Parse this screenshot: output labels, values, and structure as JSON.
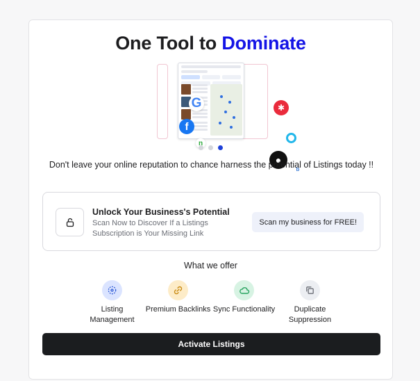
{
  "header": {
    "title_prefix": "One Tool to ",
    "title_accent": "Dominate"
  },
  "carousel": {
    "slide_count": 3,
    "active_slide": 3
  },
  "subtitle": "Don't leave your online reputation to chance harness the potential of Listings today !!",
  "promo": {
    "icon": "lock-icon",
    "title": "Unlock Your Business's Potential",
    "description": "Scan Now to Discover If a Listings Subscription is Your Missing Link",
    "button_label": "Scan my business for FREE!"
  },
  "offers": {
    "heading": "What we offer",
    "items": [
      {
        "label": "Listing Management",
        "icon": "crosshair-icon",
        "bg": "#dbe4ff",
        "fg": "#2f5bd6"
      },
      {
        "label": "Premium Backlinks",
        "icon": "link-icon",
        "bg": "#fdecc8",
        "fg": "#c98a12"
      },
      {
        "label": "Sync Functionality",
        "icon": "cloud-icon",
        "bg": "#d7f3e3",
        "fg": "#27a35f"
      },
      {
        "label": "Duplicate Suppression",
        "icon": "copy-icon",
        "bg": "#eceef2",
        "fg": "#6a6d75"
      }
    ]
  },
  "cta": {
    "label": "Activate Listings"
  },
  "colors": {
    "accent": "#1414e6",
    "cta_bg": "#1b1d1f",
    "carousel_active": "#1e40d8"
  }
}
